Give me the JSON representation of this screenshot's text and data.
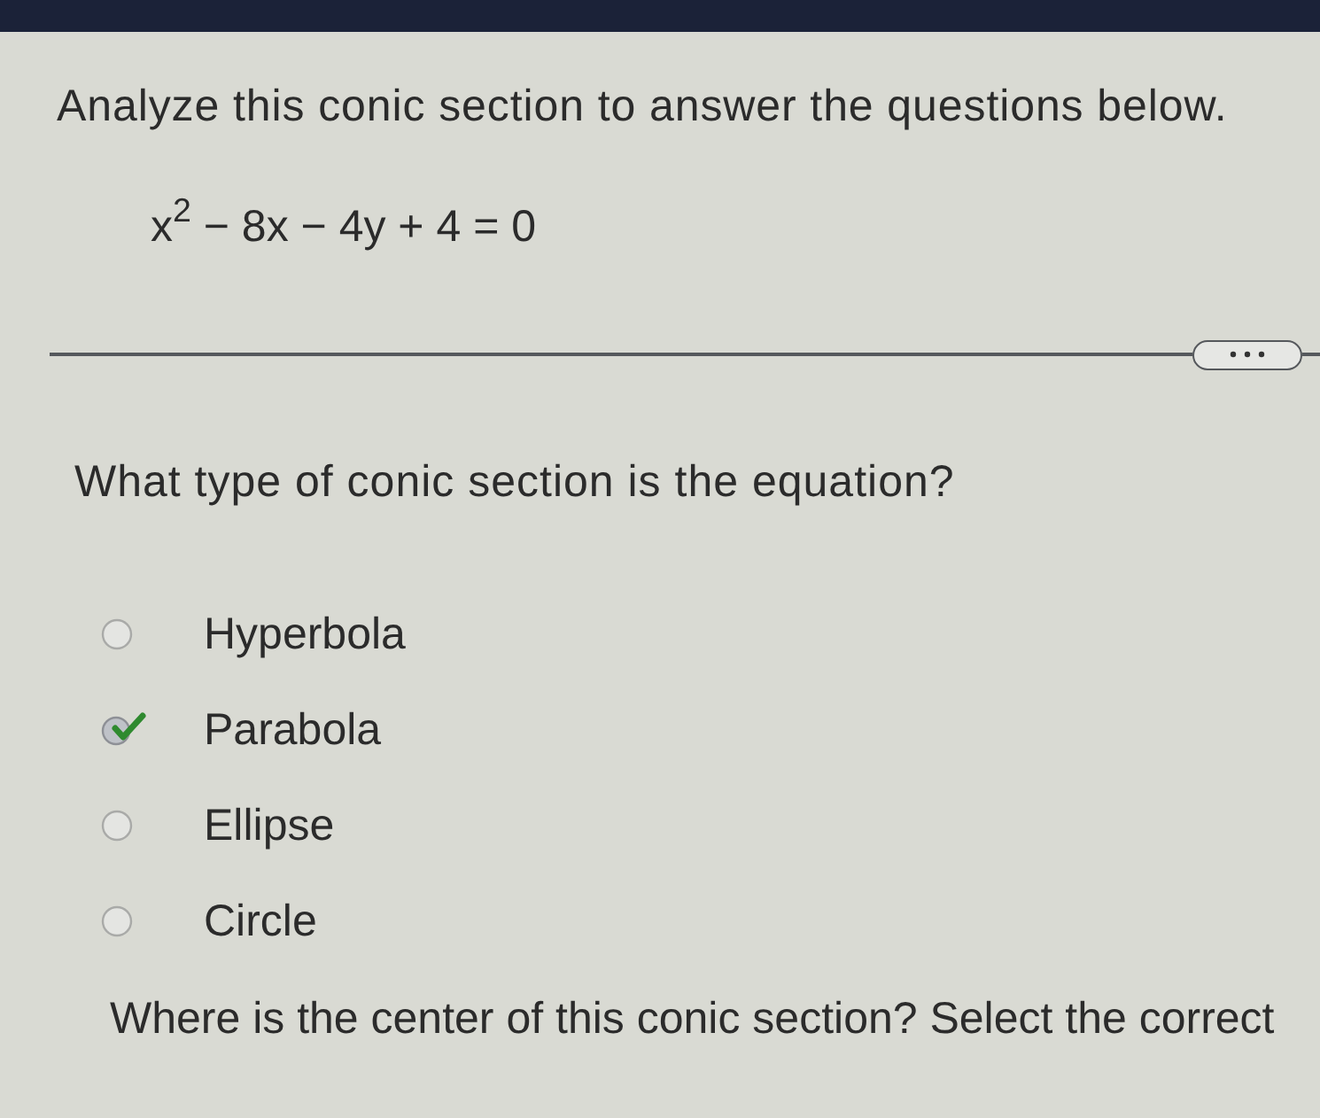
{
  "instructions": "Analyze this conic section to answer the questions below.",
  "equation": "x$^{2}$ − 8x − 4y + 4 = 0",
  "questions": [
    {
      "prompt": "What type of conic section is the equation?",
      "options": [
        {
          "label": "Hyperbola",
          "selected": false
        },
        {
          "label": "Parabola",
          "selected": true
        },
        {
          "label": "Ellipse",
          "selected": false
        },
        {
          "label": "Circle",
          "selected": false
        }
      ]
    },
    {
      "prompt": "Where is the center of this conic section? Select the correct"
    }
  ]
}
